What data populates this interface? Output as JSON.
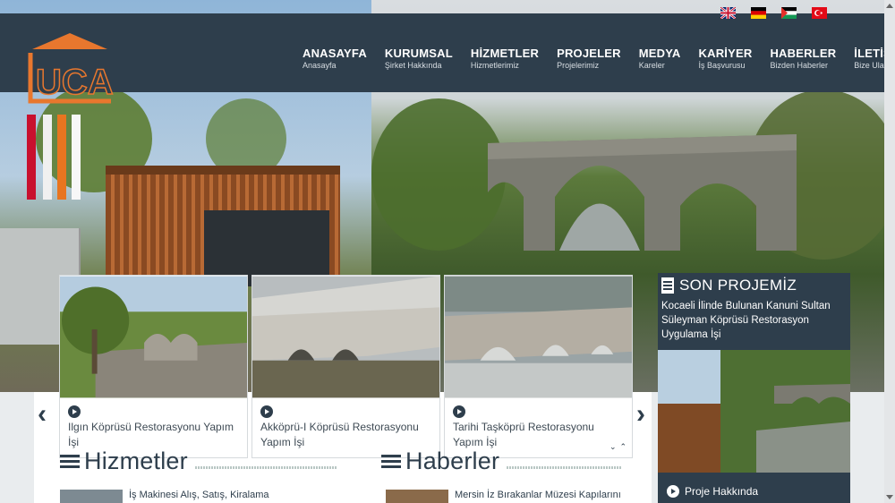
{
  "header": {
    "logo_text": "UCA",
    "nav": [
      {
        "title": "ANASAYFA",
        "subtitle": "Anasayfa"
      },
      {
        "title": "KURUMSAL",
        "subtitle": "Şirket Hakkında"
      },
      {
        "title": "HİZMETLER",
        "subtitle": "Hizmetlerimiz"
      },
      {
        "title": "PROJELER",
        "subtitle": "Projelerimiz"
      },
      {
        "title": "MEDYA",
        "subtitle": "Kareler"
      },
      {
        "title": "KARİYER",
        "subtitle": "İş Başvurusu"
      },
      {
        "title": "HABERLER",
        "subtitle": "Bizden Haberler"
      },
      {
        "title": "İLETİŞİM",
        "subtitle": "Bize Ulaşın"
      }
    ],
    "languages": [
      "uk-flag-icon",
      "germany-flag-icon",
      "palestine-flag-icon",
      "turkey-flag-icon"
    ]
  },
  "projects": [
    {
      "caption": "Ilgın Köprüsü Restorasyonu Yapım İşi"
    },
    {
      "caption": "Akköprü-I Köprüsü Restorasyonu Yapım İşi"
    },
    {
      "caption": "Tarihi Taşköprü Restorasyonu Yapım İşi"
    }
  ],
  "sidebar_project": {
    "title": "SON PROJEMİZ",
    "text": "Kocaeli İlinde Bulunan Kanuni Sultan Süleyman Köprüsü Restorasyon Uygulama İşi",
    "button": "Proje Hakkında"
  },
  "sections": {
    "services_title": "Hizmetler",
    "services_first": "İş Makinesi Alış, Satış, Kiralama",
    "news_title": "Haberler",
    "news_first": "Mersin İz Bırakanlar Müzesi Kapılarını"
  },
  "colors": {
    "primary": "#2e3e4c",
    "logo": "#e8772e"
  }
}
